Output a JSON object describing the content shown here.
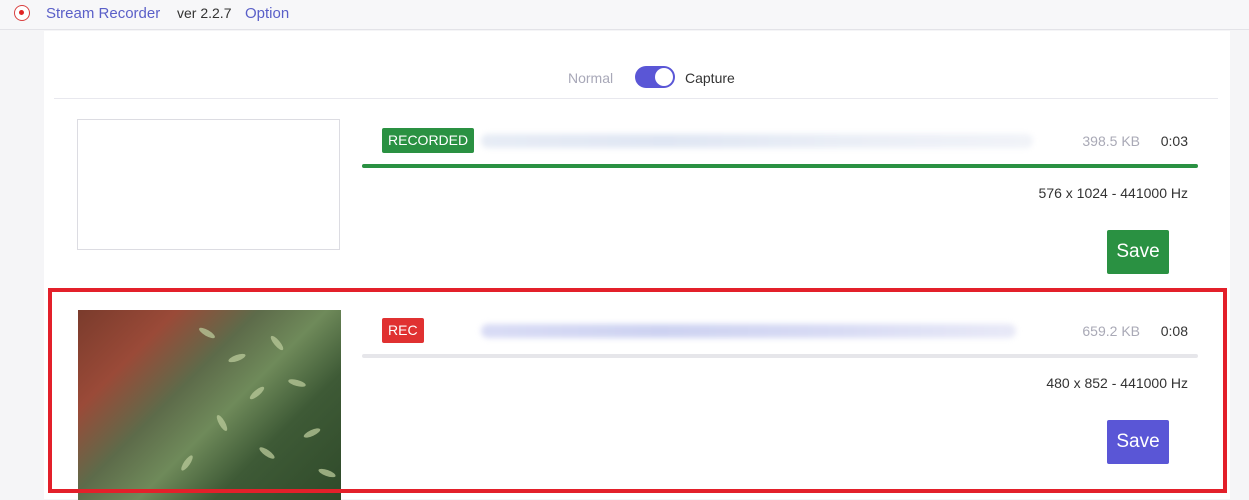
{
  "header": {
    "app_title": "Stream Recorder",
    "version": "ver 2.2.7",
    "option_link": "Option",
    "logo_icon": "record-icon"
  },
  "mode": {
    "normal_label": "Normal",
    "capture_label": "Capture",
    "capture_enabled": true
  },
  "items": [
    {
      "status": "RECORDED",
      "status_color": "#2a9142",
      "title": "",
      "size": "398.5 KB",
      "duration": "0:03",
      "progress": 1.0,
      "meta": "576 x 1024 - 441000 Hz",
      "save_label": "Save",
      "save_color": "#2a9142",
      "has_thumbnail": false
    },
    {
      "status": "REC",
      "status_color": "#e03131",
      "title": "",
      "size": "659.2 KB",
      "duration": "0:08",
      "progress": 0.0,
      "meta": "480 x 852 - 441000 Hz",
      "save_label": "Save",
      "save_color": "#5a56d6",
      "has_thumbnail": true
    }
  ],
  "colors": {
    "accent": "#5a56d6",
    "recorded": "#2a9142",
    "recording": "#e03131",
    "highlight": "#e3202a"
  }
}
